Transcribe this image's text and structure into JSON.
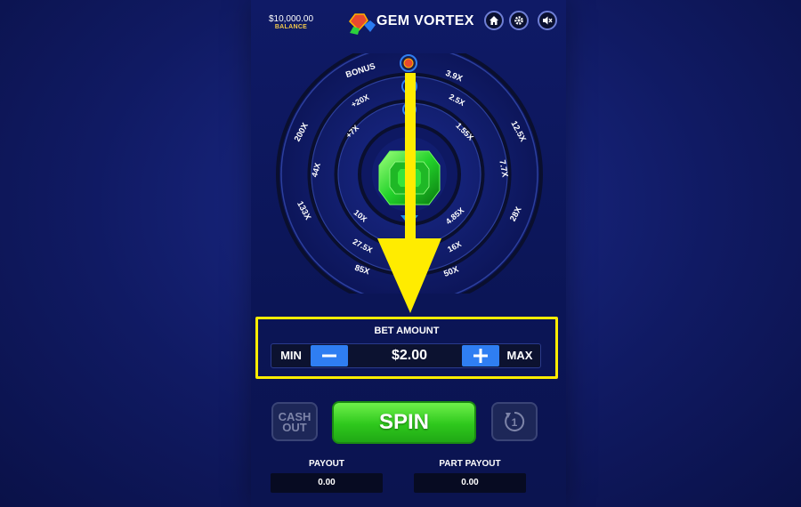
{
  "header": {
    "balance_amount": "$10,000.00",
    "balance_label": "BALANCE",
    "game_title": "GEM VORTEX",
    "icons": [
      "home-icon",
      "gear-icon",
      "mute-icon"
    ]
  },
  "wheel": {
    "outer_ring": [
      "BONUS",
      "3.9X",
      "12.5X",
      "7.7X",
      "28X",
      "50X",
      "85X",
      "133X",
      "200X"
    ],
    "middle_ring": [
      "+20X",
      "2.5X",
      "44X",
      "16X",
      "27.5X"
    ],
    "inner_ring": [
      "+7X",
      "1.55X",
      "10X",
      "4.85X"
    ],
    "center_gem": "emerald"
  },
  "bet": {
    "label": "BET AMOUNT",
    "min_label": "MIN",
    "max_label": "MAX",
    "value": "$2.00"
  },
  "controls": {
    "cashout_line1": "CASH",
    "cashout_line2": "OUT",
    "spin_label": "SPIN",
    "autoplay_count": "1"
  },
  "payout": {
    "payout_label": "PAYOUT",
    "payout_value": "0.00",
    "part_payout_label": "PART PAYOUT",
    "part_payout_value": "0.00"
  },
  "colors": {
    "accent_yellow": "#ffec00",
    "spin_green": "#2ec81c",
    "button_blue": "#2f7ef2",
    "background_navy": "#101a63"
  }
}
